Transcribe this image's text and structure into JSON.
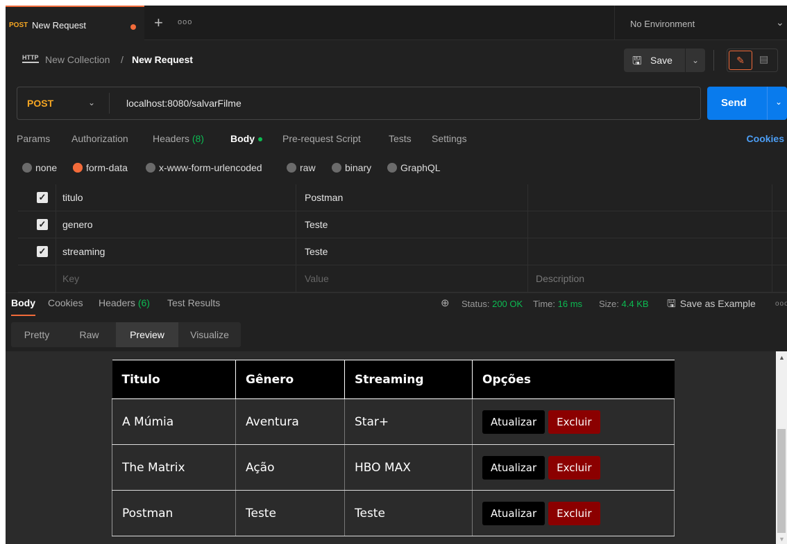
{
  "tab": {
    "method": "POST",
    "name": "New Request",
    "more": "ooo"
  },
  "environment": {
    "label": "No Environment"
  },
  "breadcrumb": {
    "icon": "HTTP",
    "collection": "New Collection",
    "separator": "/",
    "request": "New Request"
  },
  "toolbar": {
    "save_label": "Save"
  },
  "request": {
    "method": "POST",
    "url": "localhost:8080/salvarFilme",
    "send_label": "Send"
  },
  "request_tabs": [
    {
      "label": "Params"
    },
    {
      "label": "Authorization"
    },
    {
      "label": "Headers",
      "count": "(8)"
    },
    {
      "label": "Body"
    },
    {
      "label": "Pre-request Script"
    },
    {
      "label": "Tests"
    },
    {
      "label": "Settings"
    }
  ],
  "cookies_label": "Cookies",
  "body_types": [
    "none",
    "form-data",
    "x-www-form-urlencoded",
    "raw",
    "binary",
    "GraphQL"
  ],
  "form_data": [
    {
      "key": "titulo",
      "value": "Postman",
      "checked": true
    },
    {
      "key": "genero",
      "value": "Teste",
      "checked": true
    },
    {
      "key": "streaming",
      "value": "Teste",
      "checked": true
    }
  ],
  "form_placeholder": {
    "key": "Key",
    "value": "Value",
    "description": "Description"
  },
  "response_tabs": [
    {
      "label": "Body"
    },
    {
      "label": "Cookies"
    },
    {
      "label": "Headers",
      "count": "(6)"
    },
    {
      "label": "Test Results"
    }
  ],
  "response_status": {
    "status_label": "Status:",
    "status_value": "200 OK",
    "time_label": "Time:",
    "time_value": "16 ms",
    "size_label": "Size:",
    "size_value": "4.4 KB",
    "save_example": "Save as Example"
  },
  "view_tabs": [
    "Pretty",
    "Raw",
    "Preview",
    "Visualize"
  ],
  "preview_table": {
    "headers": [
      "Titulo",
      "Gênero",
      "Streaming",
      "Opções"
    ],
    "rows": [
      [
        "A Múmia",
        "Aventura",
        "Star+"
      ],
      [
        "The Matrix",
        "Ação",
        "HBO MAX"
      ],
      [
        "Postman",
        "Teste",
        "Teste"
      ]
    ],
    "update_label": "Atualizar",
    "delete_label": "Excluir"
  }
}
